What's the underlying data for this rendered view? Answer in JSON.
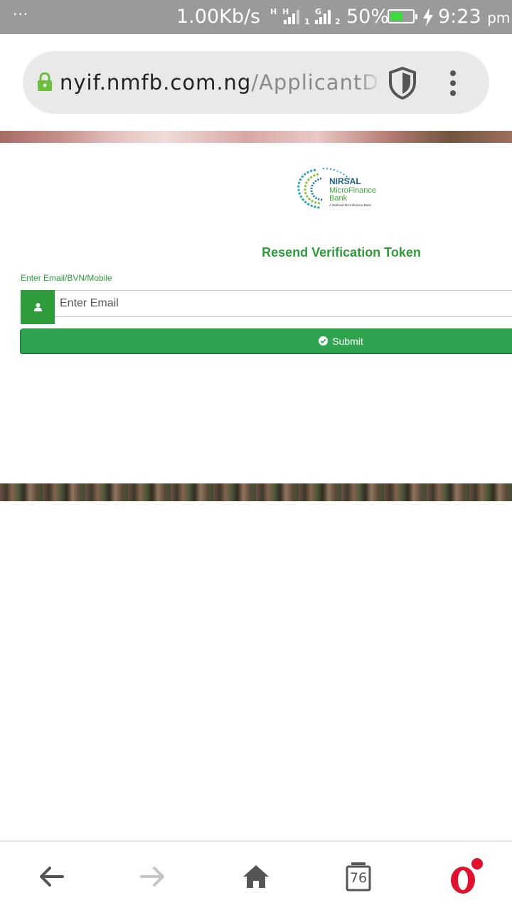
{
  "status_bar": {
    "dots": "···",
    "net_speed": "1.00Kb/s",
    "sim1_tag": "H",
    "sim1_sub": "1",
    "sim2_tag": "H",
    "sim3_tag": "G",
    "sim2_sub": "2",
    "battery_percent": "50%",
    "battery_level": 0.5,
    "time": "9:23",
    "ampm": "pm"
  },
  "browser": {
    "url_host": "nyif.nmfb.com.ng",
    "url_path": "/ApplicantDas"
  },
  "logo": {
    "line1": "NIRSAL",
    "line2": "MicroFinance",
    "line3": "Bank",
    "tagline": "A National Microfinance Bank"
  },
  "form": {
    "title": "Resend Verification Token",
    "field_label": "Enter Email/BVN/Mobile",
    "input_placeholder": "Enter Email",
    "submit_label": "Submit"
  },
  "bottom_nav": {
    "tabs_count": "76"
  },
  "colors": {
    "brand_green": "#2e9c3a",
    "button_green": "#2ea44f",
    "status_bar": "#9a9a9a",
    "opera_red": "#e0132f"
  }
}
